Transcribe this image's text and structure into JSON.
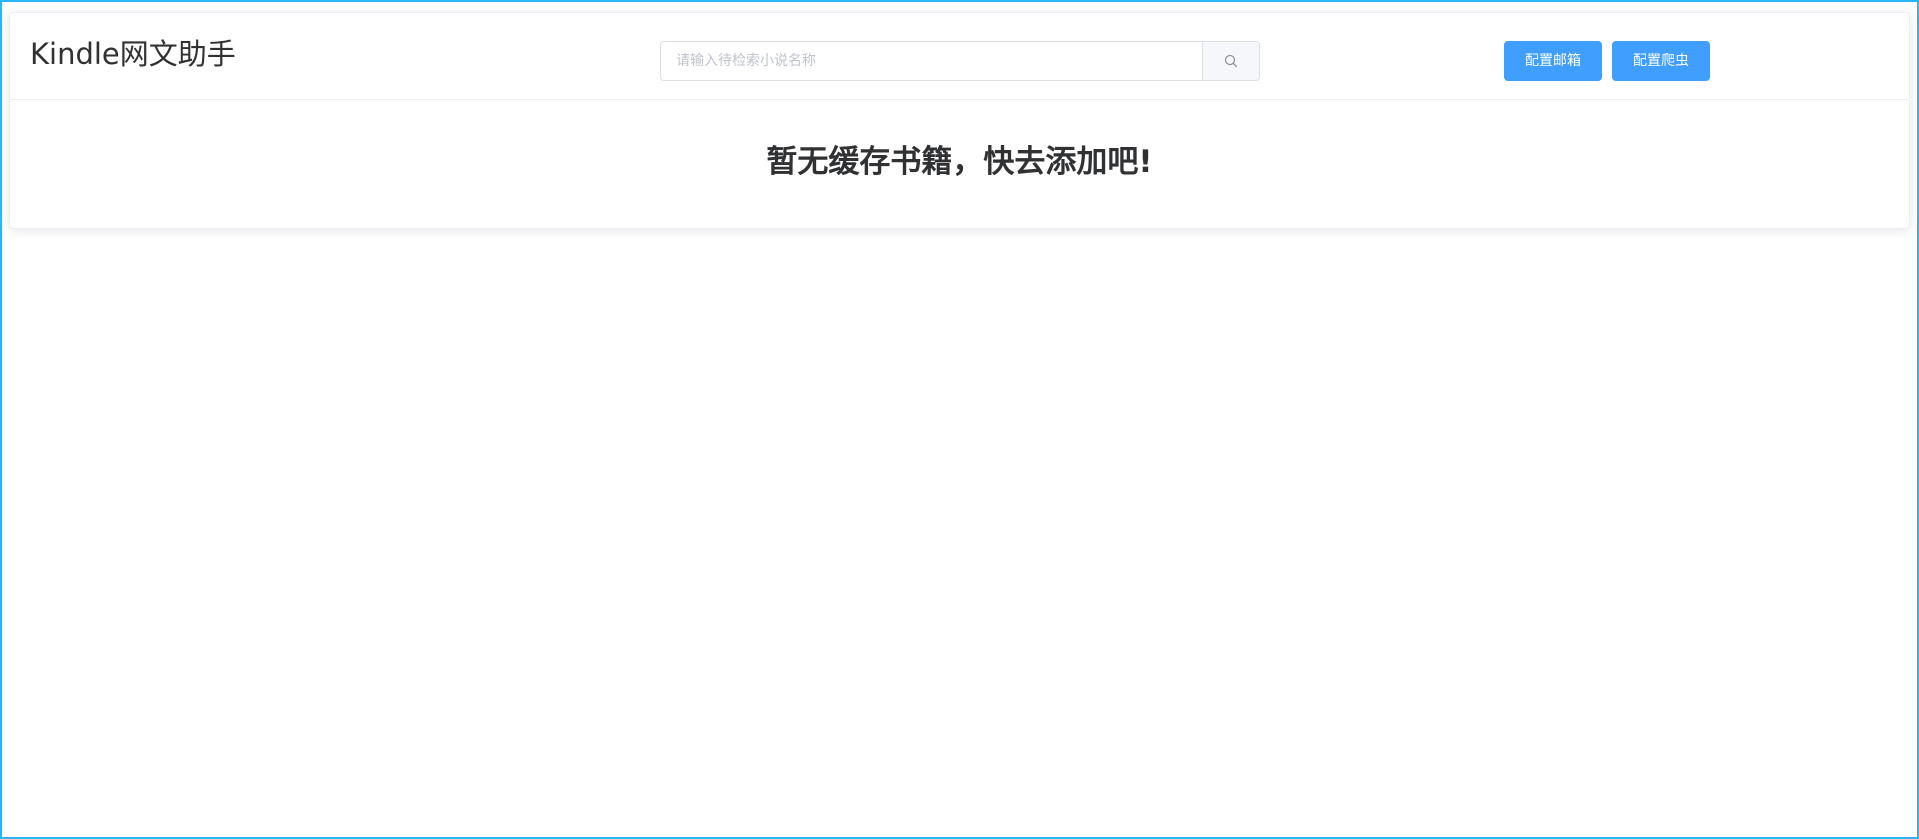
{
  "header": {
    "title": "Kindle网文助手"
  },
  "search": {
    "placeholder": "请输入待检索小说名称",
    "value": "",
    "icon": "search-icon"
  },
  "actions": {
    "config_email_label": "配置邮箱",
    "config_crawler_label": "配置爬虫"
  },
  "main": {
    "empty_message": "暂无缓存书籍，快去添加吧!"
  },
  "colors": {
    "primary": "#409eff",
    "text": "#303133",
    "border": "#dcdfe6",
    "frame": "#29b6f6"
  }
}
